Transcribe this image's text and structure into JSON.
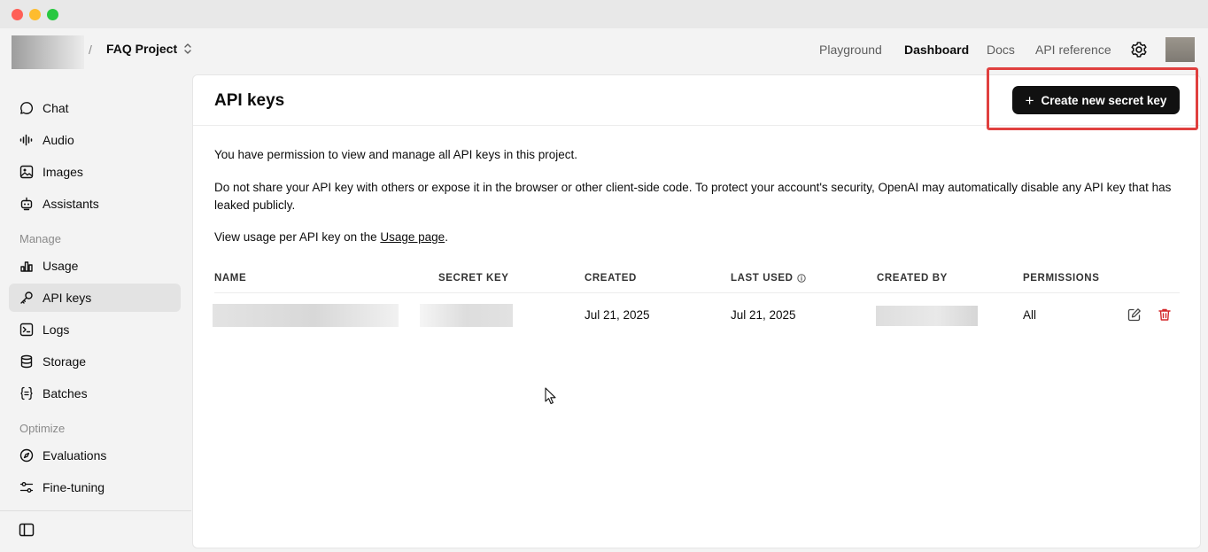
{
  "project": {
    "name": "FAQ Project",
    "crumb_separator": "/"
  },
  "nav": {
    "playground": "Playground",
    "dashboard": "Dashboard",
    "docs": "Docs",
    "api_reference": "API reference"
  },
  "sidebar": {
    "items_top": [
      {
        "label": "Chat",
        "icon": "chat-bubble-icon"
      },
      {
        "label": "Audio",
        "icon": "audio-waveform-icon"
      },
      {
        "label": "Images",
        "icon": "image-icon"
      },
      {
        "label": "Assistants",
        "icon": "robot-icon"
      }
    ],
    "manage_heading": "Manage",
    "items_manage": [
      {
        "label": "Usage",
        "icon": "bar-chart-icon"
      },
      {
        "label": "API keys",
        "icon": "key-icon",
        "active": true
      },
      {
        "label": "Logs",
        "icon": "terminal-icon"
      },
      {
        "label": "Storage",
        "icon": "database-icon"
      },
      {
        "label": "Batches",
        "icon": "braces-icon"
      }
    ],
    "optimize_heading": "Optimize",
    "items_optimize": [
      {
        "label": "Evaluations",
        "icon": "compass-icon"
      },
      {
        "label": "Fine-tuning",
        "icon": "sliders-icon"
      }
    ]
  },
  "main": {
    "title": "API keys",
    "create_button": "Create new secret key",
    "paragraph1": "You have permission to view and manage all API keys in this project.",
    "paragraph2": "Do not share your API key with others or expose it in the browser or other client-side code. To protect your account's security, OpenAI may automatically disable any API key that has leaked publicly.",
    "paragraph3_prefix": "View usage per API key on the ",
    "paragraph3_link": "Usage page",
    "paragraph3_suffix": "."
  },
  "table": {
    "headers": {
      "name": "NAME",
      "secret_key": "SECRET KEY",
      "created": "CREATED",
      "last_used": "LAST USED",
      "created_by": "CREATED BY",
      "permissions": "PERMISSIONS"
    },
    "rows": [
      {
        "created": "Jul 21, 2025",
        "last_used": "Jul 21, 2025",
        "permissions": "All"
      }
    ]
  },
  "colors": {
    "accent_button": "#111111",
    "highlight_border": "#e0403f",
    "delete_icon": "#d4282a",
    "active_sidebar": "#e3e3e3"
  }
}
